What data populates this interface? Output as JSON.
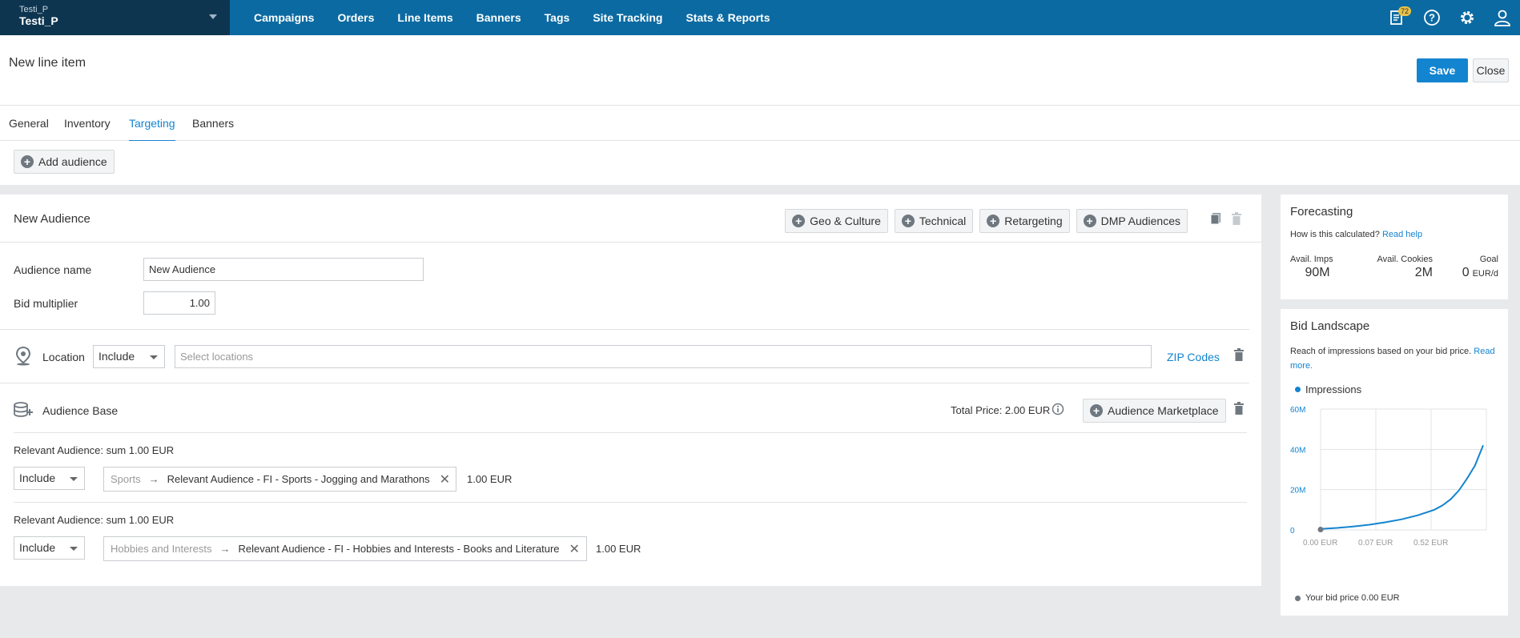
{
  "topbar": {
    "account_sub": "Testi_P",
    "account_main": "Testi_P",
    "nav": [
      "Campaigns",
      "Orders",
      "Line Items",
      "Banners",
      "Tags",
      "Site Tracking",
      "Stats & Reports"
    ],
    "notifications_count": "72"
  },
  "header": {
    "title": "New line item",
    "save_label": "Save",
    "close_label": "Close"
  },
  "tabs": [
    "General",
    "Inventory",
    "Targeting",
    "Banners"
  ],
  "add_audience_label": "Add audience",
  "audience": {
    "title": "New Audience",
    "actions": [
      "Geo & Culture",
      "Technical",
      "Retargeting",
      "DMP Audiences"
    ],
    "name_label": "Audience name",
    "name_value": "New Audience",
    "bid_label": "Bid multiplier",
    "bid_value": "1.00",
    "location": {
      "label": "Location",
      "mode": "Include",
      "placeholder": "Select locations",
      "zip_link": "ZIP Codes"
    },
    "base": {
      "label": "Audience Base",
      "total_price": "Total Price: 2.00 EUR",
      "marketplace_label": "Audience Marketplace"
    },
    "segments": [
      {
        "heading": "Relevant Audience: sum 1.00 EUR",
        "mode": "Include",
        "category": "Sports",
        "name": "Relevant Audience - FI - Sports - Jogging and Marathons",
        "price": "1.00 EUR"
      },
      {
        "heading": "Relevant Audience: sum 1.00 EUR",
        "mode": "Include",
        "category": "Hobbies and Interests",
        "name": "Relevant Audience - FI - Hobbies and Interests - Books and Literature",
        "price": "1.00 EUR"
      }
    ]
  },
  "forecasting": {
    "title": "Forecasting",
    "question": "How is this calculated?",
    "help_link": "Read help",
    "stats": [
      {
        "label": "Avail. Imps",
        "value": "90M"
      },
      {
        "label": "Avail. Cookies",
        "value": "2M"
      },
      {
        "label": "Goal",
        "value": "0",
        "unit": "EUR/d"
      }
    ]
  },
  "bid_landscape": {
    "title": "Bid Landscape",
    "description": "Reach of impressions based on your bid price.",
    "read_more": "Read more.",
    "legend": "Impressions",
    "footer": "Your bid price 0.00 EUR",
    "series_color": "#1384d0",
    "chart_data": {
      "type": "line",
      "y_ticks": [
        "60M",
        "40M",
        "20M",
        "0"
      ],
      "x_ticks": [
        "0.00 EUR",
        "0.07 EUR",
        "0.52 EUR"
      ],
      "ylim": [
        0,
        60
      ],
      "series": [
        {
          "name": "Impressions",
          "x": [
            0,
            0.1,
            0.2,
            0.3,
            0.4,
            0.5,
            0.6,
            0.7,
            0.75,
            0.8,
            0.85,
            0.9,
            0.95,
            1.0
          ],
          "values": [
            0.5,
            1.0,
            1.7,
            2.6,
            3.8,
            5.3,
            7.3,
            10.0,
            12.2,
            15.2,
            19.5,
            25.4,
            32.0,
            42.0
          ]
        }
      ]
    }
  }
}
